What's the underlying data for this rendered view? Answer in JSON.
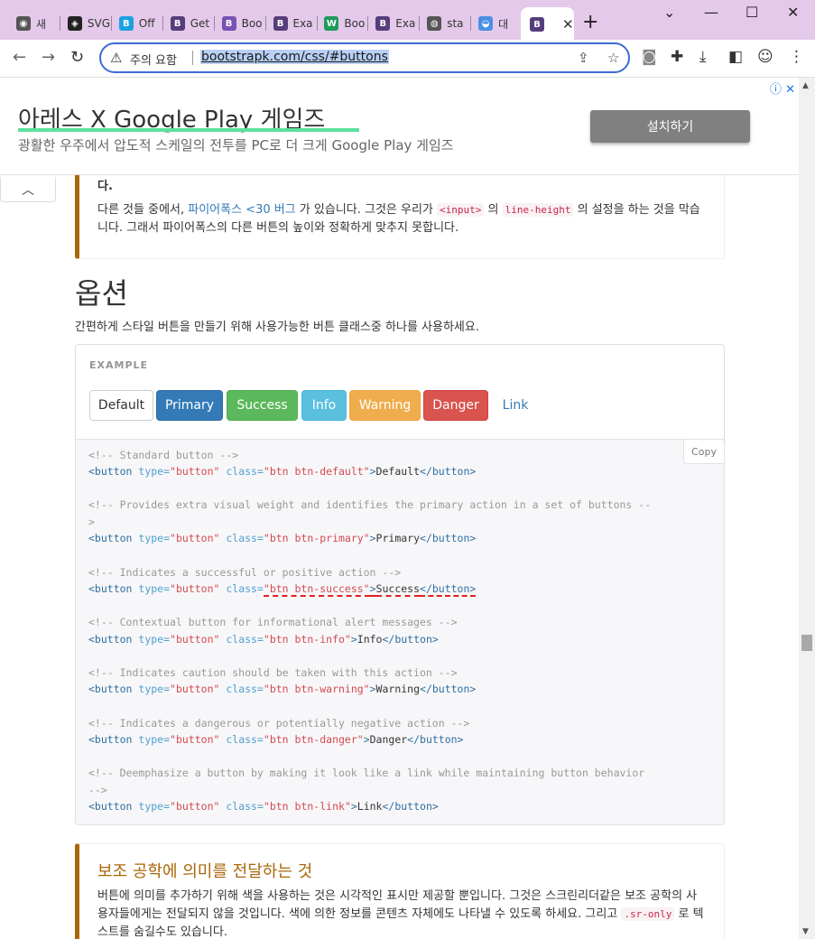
{
  "browser": {
    "tabs": [
      {
        "label": "새",
        "color": "#555555",
        "glyph": "◉"
      },
      {
        "label": "SVG",
        "color": "#222222",
        "glyph": "◈"
      },
      {
        "label": "Off",
        "color": "#1ba1e2",
        "glyph": "B"
      },
      {
        "label": "Get",
        "color": "#563d7c",
        "glyph": "B"
      },
      {
        "label": "Boo",
        "color": "#7952b3",
        "glyph": "B"
      },
      {
        "label": "Exa",
        "color": "#563d7c",
        "glyph": "B"
      },
      {
        "label": "Boo",
        "color": "#1f9a5a",
        "glyph": "W"
      },
      {
        "label": "Exa",
        "color": "#563d7c",
        "glyph": "B"
      },
      {
        "label": "sta",
        "color": "#555555",
        "glyph": "◍"
      },
      {
        "label": "대",
        "color": "#4a90e2",
        "glyph": "◒"
      }
    ],
    "active_tab": {
      "glyph": "B",
      "color": "#563d7c"
    },
    "new_tab": "+",
    "window_controls": [
      "⌄",
      "—",
      "☐",
      "✕"
    ],
    "security_label": "주의 요함",
    "url": "bootstrapk.com/css/#buttons"
  },
  "ad": {
    "title": "아레스 X Google Play 게임즈",
    "subtitle": "광활한 우주에서 압도적 스케일의 전투를 PC로 더 크게 Google Play 게임즈",
    "install_button": "설치하기"
  },
  "callout1": {
    "top_char": "다.",
    "text_1": "다른 것들 중에서, ",
    "link": "파이어폭스 <30 버그",
    "text_2": " 가 있습니다. 그것은 우리가 ",
    "code_1": "<input>",
    "text_3": " 의 ",
    "code_2": "line-height",
    "text_4": " 의 설정을 하는 것을 막습니다. 그래서 파이어폭스의 다른 버튼의 높이와 정확하게 맞추지 못합니다."
  },
  "section": {
    "heading": "옵션",
    "intro": "간편하게 스타일 버튼을 만들기 위해 사용가능한 버튼 클래스중 하나를 사용하세요."
  },
  "example": {
    "label": "EXAMPLE",
    "buttons": [
      "Default",
      "Primary",
      "Success",
      "Info",
      "Warning",
      "Danger",
      "Link"
    ],
    "colors": {
      "primary": "#337ab7",
      "success": "#5cb85c",
      "info": "#5bc0de",
      "warning": "#f0ad4e",
      "danger": "#d9534f",
      "link": "#337ab7"
    }
  },
  "code": {
    "copy_label": "Copy",
    "comments": [
      "<!-- Standard button -->",
      "<!-- Provides extra visual weight and identifies the primary action in a set of buttons --",
      ">",
      "<!-- Indicates a successful or positive action -->",
      "<!-- Contextual button for informational alert messages -->",
      "<!-- Indicates caution should be taken with this action -->",
      "<!-- Indicates a dangerous or potentially negative action -->",
      "<!-- Deemphasize a button by making it look like a link while maintaining button behavior",
      "-->"
    ],
    "tag_open": "<button",
    "attr_type": "type=",
    "val_type": "\"button\"",
    "attr_class": "class=",
    "classes": [
      "\"btn btn-default\"",
      "\"btn btn-primary\"",
      "\"btn btn-success\"",
      "\"btn btn-info\"",
      "\"btn btn-warning\"",
      "\"btn btn-danger\"",
      "\"btn btn-link\""
    ],
    "gt": ">",
    "close_tag": "</button>"
  },
  "callout2": {
    "title": "보조 공학에 의미를 전달하는 것",
    "text_1": "버튼에 의미를 추가하기 위해 색을 사용하는 것은 시각적인 표시만 제공할 뿐입니다. 그것은 스크린리더같은 보조 공학의 사용자들에게는 전달되지 않을 것입니다. 색에 의한 정보를 콘텐츠 자체에도 나타낼 수 있도록 하세요. 그리고 ",
    "code": ".sr-only",
    "text_2": " 로 텍스트를 숨길수도 있습니다."
  }
}
